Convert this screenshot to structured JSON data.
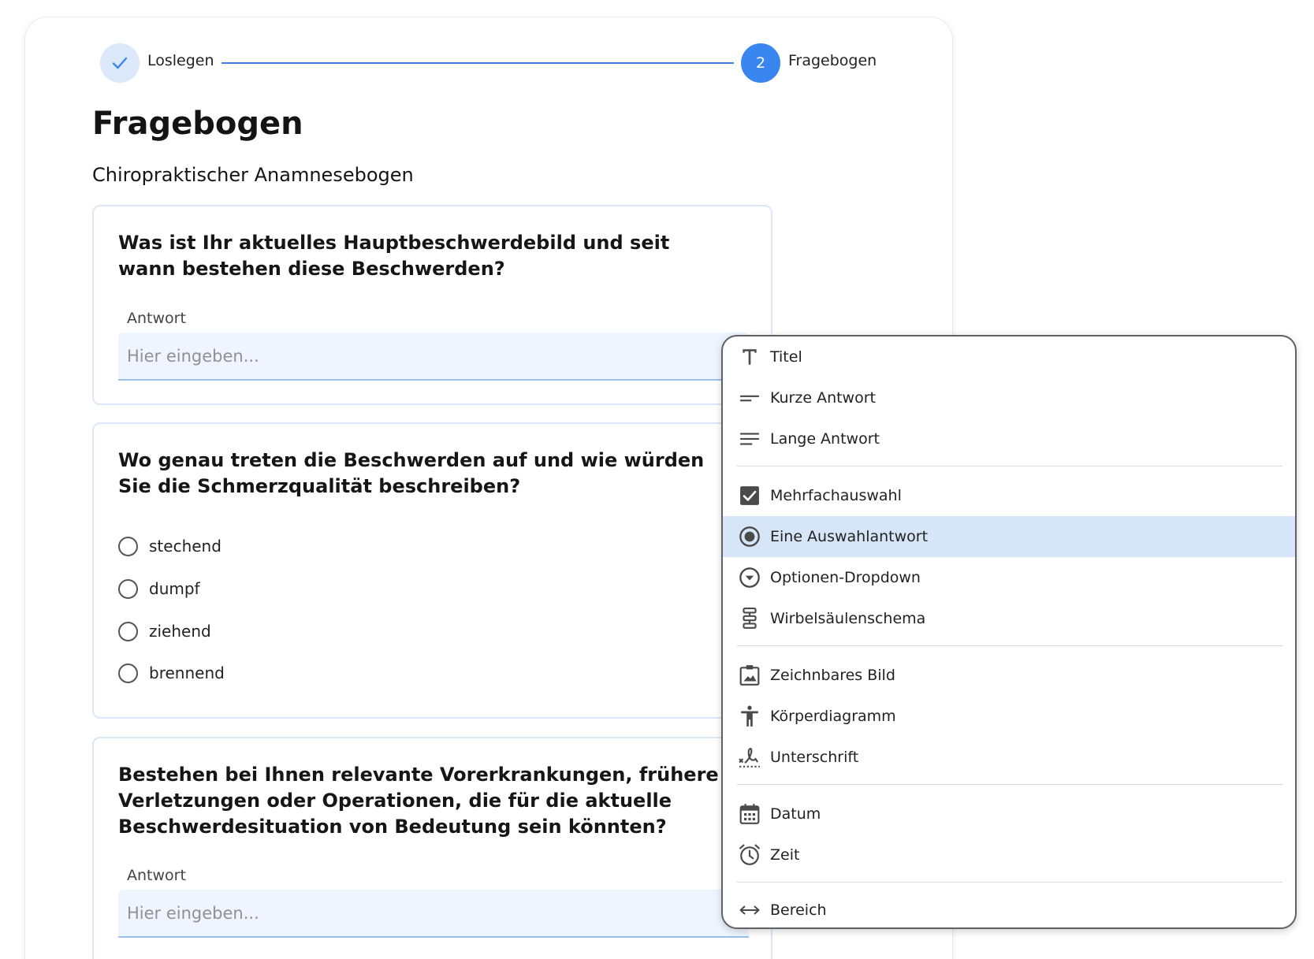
{
  "stepper": {
    "step1_label": "Loslegen",
    "step2_number": "2",
    "step2_label": "Fragebogen"
  },
  "page": {
    "title": "Fragebogen",
    "subtitle": "Chiropraktischer Anamnesebogen"
  },
  "questions": [
    {
      "text": "Was ist Ihr aktuelles Hauptbeschwerdebild und seit wann bestehen diese Beschwerden?",
      "answer_label": "Antwort",
      "placeholder": "Hier eingeben..."
    },
    {
      "text": "Wo genau treten die Beschwerden auf und wie würden Sie die Schmerzqualität beschreiben?",
      "options": [
        "stechend",
        "dumpf",
        "ziehend",
        "brennend"
      ]
    },
    {
      "text": "Bestehen bei Ihnen relevante Vorerkrankungen, frühere Verletzungen oder Operationen, die für die aktuelle Beschwerdesituation von Bedeutung sein könnten?",
      "answer_label": "Antwort",
      "placeholder": "Hier eingeben..."
    }
  ],
  "menu": {
    "items": [
      {
        "label": "Titel",
        "icon": "title-icon"
      },
      {
        "label": "Kurze Antwort",
        "icon": "short-text-icon"
      },
      {
        "label": "Lange Antwort",
        "icon": "long-text-icon"
      },
      {
        "label": "Mehrfachauswahl",
        "icon": "checkbox-icon"
      },
      {
        "label": "Eine Auswahlantwort",
        "icon": "radio-icon"
      },
      {
        "label": "Optionen-Dropdown",
        "icon": "dropdown-circle-icon"
      },
      {
        "label": "Wirbelsäulenschema",
        "icon": "spine-icon"
      },
      {
        "label": "Zeichnbares Bild",
        "icon": "drawable-image-icon"
      },
      {
        "label": "Körperdiagramm",
        "icon": "body-figure-icon"
      },
      {
        "label": "Unterschrift",
        "icon": "signature-icon"
      },
      {
        "label": "Datum",
        "icon": "calendar-icon"
      },
      {
        "label": "Zeit",
        "icon": "alarm-clock-icon"
      },
      {
        "label": "Bereich",
        "icon": "range-arrows-icon"
      }
    ],
    "selected": "Eine Auswahlantwort"
  },
  "colors": {
    "accent": "#3a86f0",
    "selected_bg": "#d6e5f8",
    "input_bg": "#eef5ff"
  }
}
